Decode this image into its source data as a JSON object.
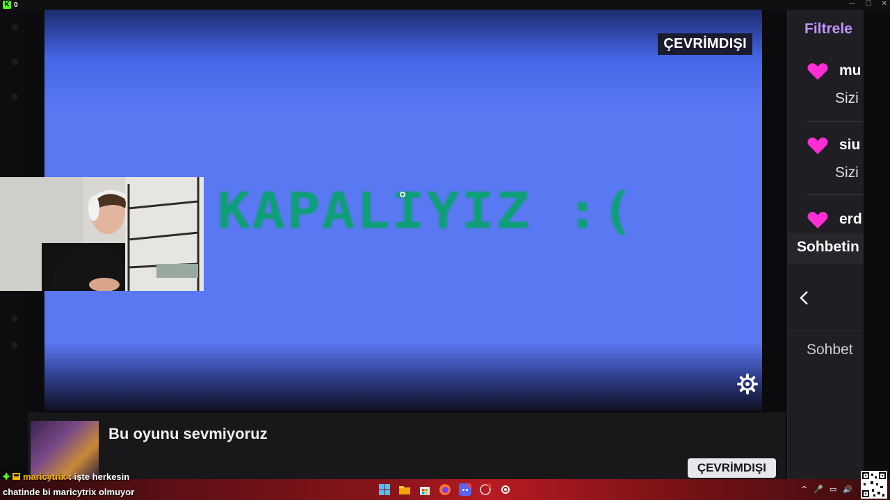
{
  "kick": {
    "count": "0"
  },
  "window_controls": {
    "minimize": "—",
    "maximize": "☐",
    "close": "✕"
  },
  "player": {
    "status_badge": "ÇEVRİMDIŞI",
    "offline_text": "KAPALIYIZ :(",
    "text_color": "#0e9f77",
    "bg_color": "#5a78f2"
  },
  "info": {
    "stream_title": "Bu oyunu sevmiyoruz",
    "status_button": "ÇEVRİMDIŞI"
  },
  "chat": {
    "filter_title": "Filtrele",
    "close": "✕",
    "items": [
      {
        "user": "mu",
        "sub": "Sizi"
      },
      {
        "user": "siu",
        "sub": "Sizi"
      },
      {
        "user": "erd",
        "sub": ""
      }
    ],
    "header": "Sohbetin",
    "footer": "Sohbet",
    "heart_color": "#ff2fd4"
  },
  "overlay_chat": {
    "username": "maricytrix",
    "separator": " : ",
    "message_line1": "işte herkesin",
    "message_line2": "chatinde bi maricytrix olmuyor"
  },
  "taskbar": {
    "icons": [
      "windows-start-icon",
      "file-explorer-icon",
      "store-icon",
      "firefox-icon",
      "discord-icon",
      "steam-like-icon",
      "steelseries-icon"
    ],
    "tray": [
      "^",
      "🎤",
      "▭",
      "🔊"
    ]
  }
}
